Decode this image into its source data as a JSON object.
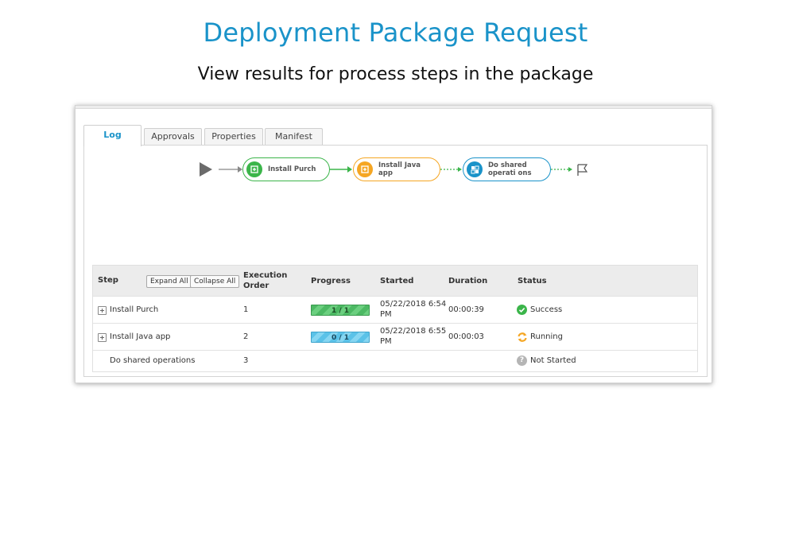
{
  "page": {
    "title": "Deployment Package Request",
    "subtitle": "View results for process steps in the package"
  },
  "tabs": [
    {
      "label": "Log",
      "active": true
    },
    {
      "label": "Approvals",
      "active": false
    },
    {
      "label": "Properties",
      "active": false
    },
    {
      "label": "Manifest",
      "active": false
    }
  ],
  "flow": {
    "nodes": [
      {
        "label": "Install Purch",
        "state": "success",
        "color": "#3bb54a"
      },
      {
        "label": "Install Java app",
        "state": "running",
        "color": "#f5a623"
      },
      {
        "label": "Do shared operati ons",
        "state": "not-started",
        "color": "#1a93c9"
      }
    ]
  },
  "table": {
    "headers": {
      "step": "Step",
      "expand_all": "Expand All",
      "collapse_all": "Collapse All",
      "execution_order_1": "Execution",
      "execution_order_2": "Order",
      "progress": "Progress",
      "started": "Started",
      "duration": "Duration",
      "status": "Status"
    },
    "rows": [
      {
        "step": "Install Purch",
        "order": "1",
        "progress": "1 / 1",
        "started_1": "05/22/2018 6:54",
        "started_2": "PM",
        "duration": "00:00:39",
        "status": "Success"
      },
      {
        "step": "Install Java app",
        "order": "2",
        "progress": "0 / 1",
        "started_1": "05/22/2018 6:55",
        "started_2": "PM",
        "duration": "00:00:03",
        "status": "Running"
      },
      {
        "step": "Do shared operations",
        "order": "3",
        "progress": "",
        "started_1": "",
        "started_2": "",
        "duration": "",
        "status": "Not Started"
      }
    ]
  },
  "colors": {
    "accent": "#1a93c9",
    "success": "#3bb54a",
    "running": "#f5a623",
    "not_started": "#b5b5b5"
  }
}
